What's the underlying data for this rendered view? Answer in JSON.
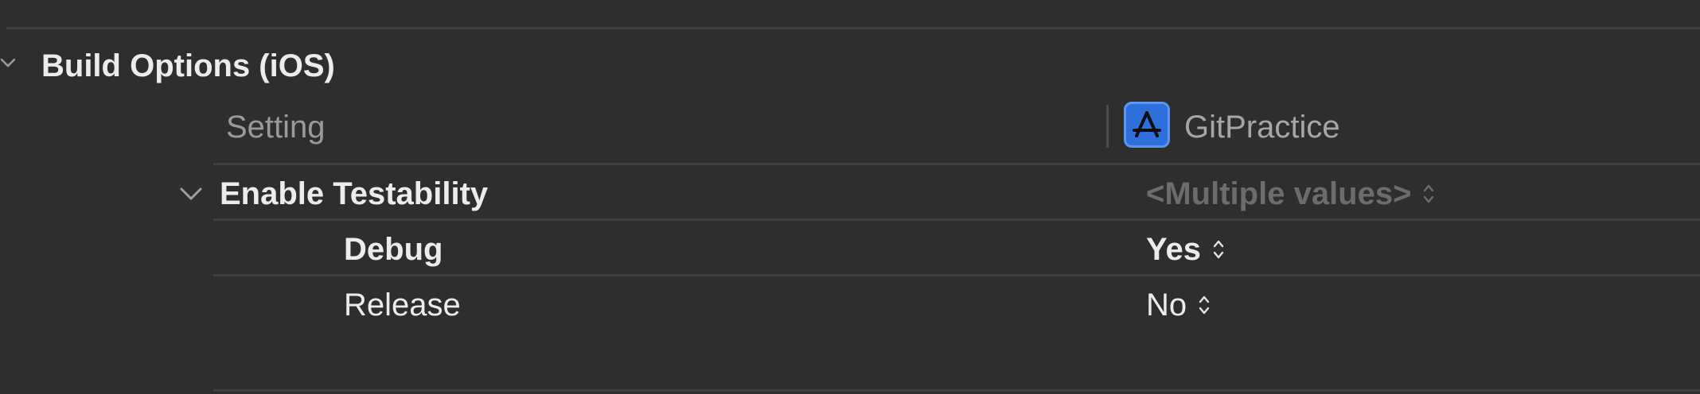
{
  "section": {
    "title": "Build Options (iOS)",
    "icon": "chevron-down-icon"
  },
  "columns": {
    "setting_header": "Setting",
    "target_name": "GitPractice",
    "target_icon": "app-store-icon"
  },
  "setting": {
    "title": "Enable Testability",
    "value": "<Multiple values>",
    "configurations": [
      {
        "name": "Debug",
        "value": "Yes"
      },
      {
        "name": "Release",
        "value": "No"
      }
    ]
  },
  "colors": {
    "background": "#2e2e2e",
    "divider": "#3f3f3f",
    "text_primary": "#ececec",
    "text_secondary": "#9a9a9a",
    "text_disabled": "#6c6c6c",
    "accent": "#2f6fdc"
  }
}
